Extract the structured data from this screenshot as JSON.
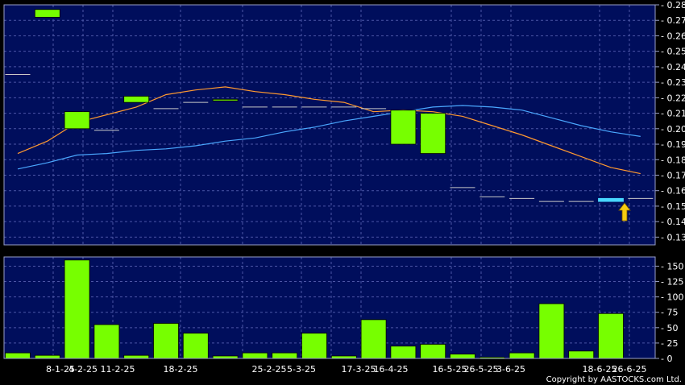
{
  "chart_data": [
    {
      "type": "candlestick",
      "panel": "price",
      "x_labels": [
        "8-1-25",
        "4-2-25",
        "11-2-25",
        "18-2-25",
        "25-2-25",
        "5-3-25",
        "17-3-25",
        "16-4-25",
        "16-5-25",
        "26-5-25",
        "3-6-25",
        "18-6-25",
        "26-6-25"
      ],
      "ylim": [
        0.125,
        0.28
      ],
      "y_ticks": [
        0.13,
        0.14,
        0.15,
        0.16,
        0.17,
        0.18,
        0.19,
        0.2,
        0.21,
        0.22,
        0.23,
        0.24,
        0.25,
        0.26,
        0.27,
        0.28
      ],
      "grid": true,
      "candles": [
        {
          "o": 0.235,
          "c": 0.235
        },
        {
          "o": 0.272,
          "c": 0.277
        },
        {
          "o": 0.2,
          "c": 0.211
        },
        {
          "o": 0.199,
          "c": 0.199
        },
        {
          "o": 0.217,
          "c": 0.221
        },
        {
          "o": 0.213,
          "c": 0.213
        },
        {
          "o": 0.217,
          "c": 0.217
        },
        {
          "o": 0.218,
          "c": 0.219
        },
        {
          "o": 0.214,
          "c": 0.214
        },
        {
          "o": 0.214,
          "c": 0.214
        },
        {
          "o": 0.214,
          "c": 0.214
        },
        {
          "o": 0.214,
          "c": 0.214
        },
        {
          "o": 0.213,
          "c": 0.213
        },
        {
          "o": 0.19,
          "c": 0.212
        },
        {
          "o": 0.184,
          "c": 0.21
        },
        {
          "o": 0.162,
          "c": 0.162
        },
        {
          "o": 0.156,
          "c": 0.156
        },
        {
          "o": 0.155,
          "c": 0.155
        },
        {
          "o": 0.153,
          "c": 0.153
        },
        {
          "o": 0.153,
          "c": 0.153
        },
        {
          "o": 0.153,
          "c": 0.155
        },
        {
          "o": 0.155,
          "c": 0.155
        }
      ],
      "series": [
        {
          "points": [
            [
              0,
              0.184
            ],
            [
              1,
              0.192
            ],
            [
              2,
              0.204
            ],
            [
              3,
              0.209
            ],
            [
              4,
              0.214
            ],
            [
              5,
              0.222
            ],
            [
              6,
              0.225
            ],
            [
              7,
              0.227
            ],
            [
              8,
              0.224
            ],
            [
              9,
              0.222
            ],
            [
              10,
              0.219
            ],
            [
              11,
              0.217
            ],
            [
              12,
              0.211
            ],
            [
              13,
              0.212
            ],
            [
              14,
              0.211
            ],
            [
              15,
              0.208
            ],
            [
              16,
              0.202
            ],
            [
              17,
              0.196
            ],
            [
              18,
              0.189
            ],
            [
              19,
              0.182
            ],
            [
              20,
              0.175
            ],
            [
              21,
              0.171
            ]
          ],
          "color": "#ff9a30"
        },
        {
          "points": [
            [
              0,
              0.174
            ],
            [
              1,
              0.178
            ],
            [
              2,
              0.183
            ],
            [
              3,
              0.184
            ],
            [
              4,
              0.186
            ],
            [
              5,
              0.187
            ],
            [
              6,
              0.189
            ],
            [
              7,
              0.192
            ],
            [
              8,
              0.194
            ],
            [
              9,
              0.198
            ],
            [
              10,
              0.201
            ],
            [
              11,
              0.205
            ],
            [
              12,
              0.208
            ],
            [
              13,
              0.211
            ],
            [
              14,
              0.214
            ],
            [
              15,
              0.215
            ],
            [
              16,
              0.214
            ],
            [
              17,
              0.212
            ],
            [
              18,
              0.207
            ],
            [
              19,
              0.202
            ],
            [
              20,
              0.198
            ],
            [
              21,
              0.195
            ]
          ],
          "color": "#4aa8ff"
        }
      ],
      "colors": {
        "background": "#000e5c",
        "grid": "#4b56a6",
        "candle": "#77ff00",
        "highlight": "#48d6ff",
        "arrow": "#f7cc10",
        "frame": "#9aa0c8",
        "text": "#ffffff"
      }
    },
    {
      "type": "bar",
      "panel": "volume",
      "ylim": [
        0,
        165
      ],
      "y_ticks": [
        0,
        25,
        50,
        75,
        100,
        125,
        150
      ],
      "grid": true,
      "values": [
        9,
        5,
        160,
        55,
        5,
        57,
        41,
        4,
        9,
        9,
        41,
        4,
        63,
        20,
        23,
        7,
        2,
        9,
        89,
        12,
        73,
        0
      ],
      "colors": {
        "bar": "#77ff00"
      }
    }
  ],
  "copyright": "Copyright by AASTOCKS.com Ltd."
}
